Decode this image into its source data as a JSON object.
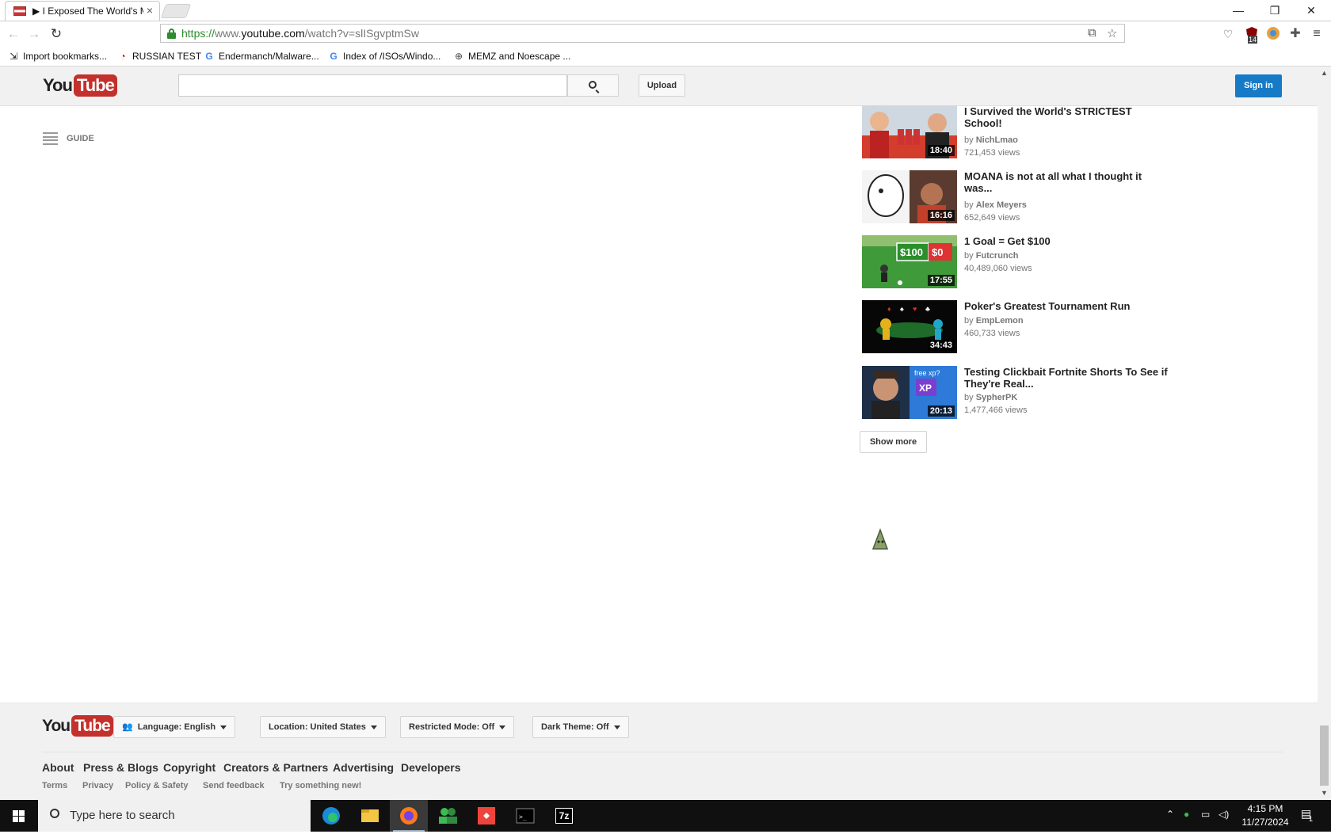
{
  "browser": {
    "tab_title": "▶ I Exposed The World's M",
    "url_scheme": "https://",
    "url_pre": "www.",
    "url_host": "youtube.com",
    "url_path": "/watch?v=slISgvptmSw",
    "ext_badge": "14",
    "bookmarks": [
      "Import bookmarks...",
      "RUSSIAN TEST",
      "Endermanch/Malware...",
      "Index of /ISOs/Windo...",
      "MEMZ and Noescape ..."
    ]
  },
  "youtube": {
    "logo_you": "You",
    "logo_tube": "Tube",
    "search_placeholder": "",
    "upload_label": "Upload",
    "signin_label": "Sign in",
    "guide_label": "GUIDE",
    "related": [
      {
        "title": "I Survived the World's STRICTEST School!",
        "channel": "NichLmao",
        "views": "721,453 views",
        "duration": "18:40"
      },
      {
        "title": "MOANA is not at all what I thought it was...",
        "channel": "Alex Meyers",
        "views": "652,649 views",
        "duration": "16:16"
      },
      {
        "title": "1 Goal = Get $100",
        "channel": "Futcrunch",
        "views": "40,489,060 views",
        "duration": "17:55"
      },
      {
        "title": "Poker's Greatest Tournament Run",
        "channel": "EmpLemon",
        "views": "460,733 views",
        "duration": "34:43"
      },
      {
        "title": "Testing Clickbait Fortnite Shorts To See if They're Real...",
        "channel": "SypherPK",
        "views": "1,477,466 views",
        "duration": "20:13"
      }
    ],
    "by_prefix": "by",
    "show_more": "Show more",
    "thumb_text": {
      "goal_100": "$100",
      "goal_0": "$0",
      "free_xp": "free xp?",
      "xp": "XP"
    },
    "footer": {
      "language": "Language: English",
      "location": "Location: United States",
      "restricted": "Restricted Mode: Off",
      "dark": "Dark Theme: Off",
      "links": [
        "About",
        "Press & Blogs",
        "Copyright",
        "Creators & Partners",
        "Advertising",
        "Developers"
      ],
      "sublinks": [
        "Terms",
        "Privacy",
        "Policy & Safety",
        "Send feedback",
        "Try something new!"
      ]
    }
  },
  "taskbar": {
    "search_placeholder": "Type here to search",
    "time": "4:15 PM",
    "date": "11/27/2024",
    "sevenzip_label": "7z",
    "notif_count": "1"
  },
  "colors": {
    "yt_red": "#c4302b",
    "signin_blue": "#167ac6",
    "secure_green": "#2e8b2e"
  }
}
